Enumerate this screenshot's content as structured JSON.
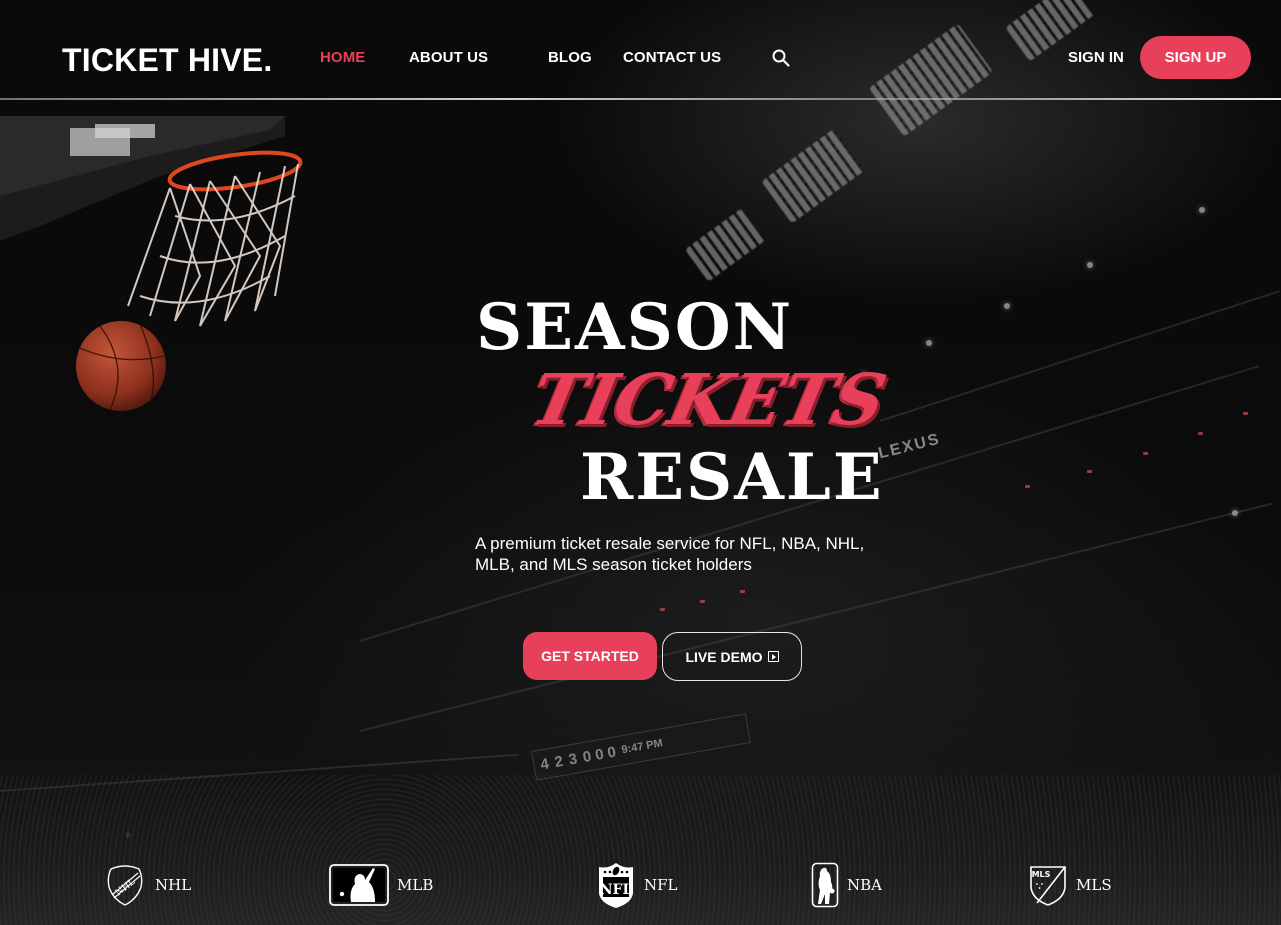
{
  "brand": {
    "name": "TICKET HIVE.",
    "accent_color": "#e8405a"
  },
  "nav": {
    "items": [
      {
        "label": "HOME",
        "active": true
      },
      {
        "label": "ABOUT US",
        "active": false
      },
      {
        "label": "BLOG",
        "active": false
      },
      {
        "label": "CONTACT US",
        "active": false
      }
    ],
    "search_icon": "search-icon",
    "sign_in": "SIGN IN",
    "sign_up": "SIGN UP"
  },
  "hero": {
    "line1": "SEASON",
    "line2": "TICKETS",
    "line3": "RESALE",
    "subtitle": "A premium ticket resale service for NFL, NBA, NHL, MLB, and MLS season ticket holders",
    "primary_cta": "GET STARTED",
    "secondary_cta": "LIVE DEMO",
    "secondary_cta_icon": "play-square-icon"
  },
  "background": {
    "sponsor_sign": "LEXUS",
    "scoreboard": {
      "scores": [
        "4",
        "2",
        "3"
      ],
      "innings": "0 0 0",
      "time": "9:47 PM"
    }
  },
  "leagues": [
    {
      "name": "NHL",
      "icon": "nhl-shield-icon"
    },
    {
      "name": "MLB",
      "icon": "mlb-batter-icon"
    },
    {
      "name": "NFL",
      "icon": "nfl-shield-icon"
    },
    {
      "name": "NBA",
      "icon": "nba-player-icon"
    },
    {
      "name": "MLS",
      "icon": "mls-crest-icon"
    }
  ]
}
